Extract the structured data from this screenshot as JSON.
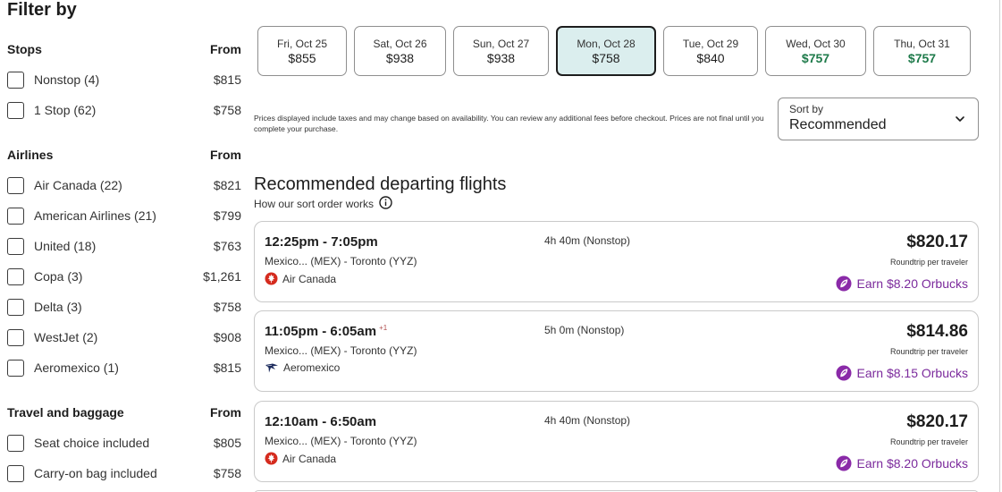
{
  "filters": {
    "title": "Filter by",
    "groups": [
      {
        "name": "Stops",
        "from_label": "From",
        "options": [
          {
            "label": "Nonstop (4)",
            "price": "$815"
          },
          {
            "label": "1 Stop (62)",
            "price": "$758"
          }
        ]
      },
      {
        "name": "Airlines",
        "from_label": "From",
        "options": [
          {
            "label": "Air Canada (22)",
            "price": "$821"
          },
          {
            "label": "American Airlines (21)",
            "price": "$799"
          },
          {
            "label": "United (18)",
            "price": "$763"
          },
          {
            "label": "Copa (3)",
            "price": "$1,261"
          },
          {
            "label": "Delta (3)",
            "price": "$758"
          },
          {
            "label": "WestJet (2)",
            "price": "$908"
          },
          {
            "label": "Aeromexico (1)",
            "price": "$815"
          }
        ]
      },
      {
        "name": "Travel and baggage",
        "from_label": "From",
        "options": [
          {
            "label": "Seat choice included",
            "price": "$805"
          },
          {
            "label": "Carry-on bag included",
            "price": "$758"
          }
        ]
      }
    ]
  },
  "dates": [
    {
      "label": "Fri, Oct 25",
      "price": "$855",
      "selected": false,
      "lowest": false
    },
    {
      "label": "Sat, Oct 26",
      "price": "$938",
      "selected": false,
      "lowest": false
    },
    {
      "label": "Sun, Oct 27",
      "price": "$938",
      "selected": false,
      "lowest": false
    },
    {
      "label": "Mon, Oct 28",
      "price": "$758",
      "selected": true,
      "lowest": false
    },
    {
      "label": "Tue, Oct 29",
      "price": "$840",
      "selected": false,
      "lowest": false
    },
    {
      "label": "Wed, Oct 30",
      "price": "$757",
      "selected": false,
      "lowest": true
    },
    {
      "label": "Thu, Oct 31",
      "price": "$757",
      "selected": false,
      "lowest": true
    }
  ],
  "disclaimer": "Prices displayed include taxes and may change based on availability. You can review any additional fees before checkout. Prices are not final until you complete your purchase.",
  "sort": {
    "label": "Sort by",
    "value": "Recommended"
  },
  "results": {
    "title": "Recommended departing flights",
    "how_sort": "How our sort order works"
  },
  "flights": [
    {
      "times": "12:25pm - 7:05pm",
      "next_day": "",
      "route": "Mexico... (MEX) - Toronto (YYZ)",
      "airline": "Air Canada",
      "airline_icon": "maple-leaf-icon",
      "duration": "4h 40m (Nonstop)",
      "price": "$820.17",
      "price_note": "Roundtrip per traveler",
      "earn": "Earn $8.20 Orbucks"
    },
    {
      "times": "11:05pm - 6:05am",
      "next_day": "+1",
      "route": "Mexico... (MEX) - Toronto (YYZ)",
      "airline": "Aeromexico",
      "airline_icon": "eagle-icon",
      "duration": "5h 0m (Nonstop)",
      "price": "$814.86",
      "price_note": "Roundtrip per traveler",
      "earn": "Earn $8.15 Orbucks"
    },
    {
      "times": "12:10am - 6:50am",
      "next_day": "",
      "route": "Mexico... (MEX) - Toronto (YYZ)",
      "airline": "Air Canada",
      "airline_icon": "maple-leaf-icon",
      "duration": "4h 40m (Nonstop)",
      "price": "$820.17",
      "price_note": "Roundtrip per traveler",
      "earn": "Earn $8.20 Orbucks"
    }
  ],
  "colors": {
    "selected_date_bg": "#dbeeee",
    "lowest_price": "#1e7a4a",
    "orbucks": "#7b2a9c",
    "air_canada_red": "#d52b1e",
    "aeromexico_navy": "#1b2a5c"
  }
}
